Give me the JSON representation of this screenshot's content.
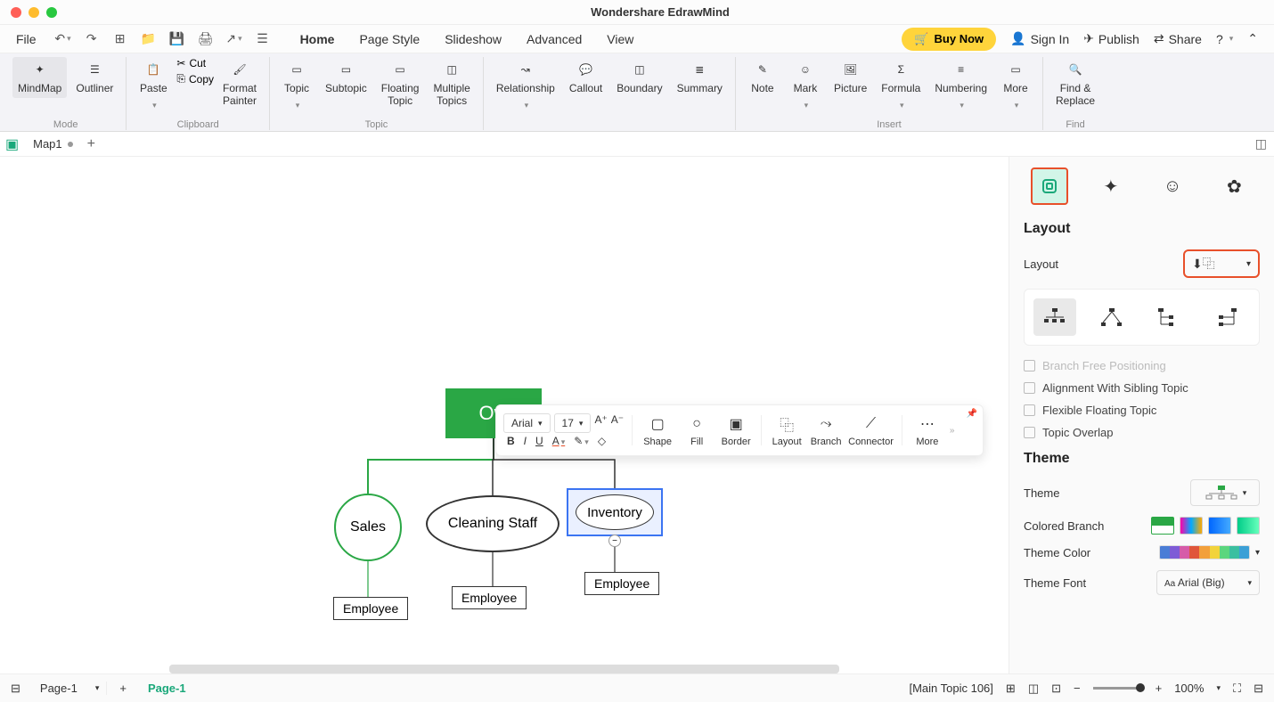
{
  "app_title": "Wondershare EdrawMind",
  "menubar": {
    "file": "File",
    "tabs": [
      "Home",
      "Page Style",
      "Slideshow",
      "Advanced",
      "View"
    ],
    "active_tab": "Home",
    "buy_now": "Buy Now",
    "sign_in": "Sign In",
    "publish": "Publish",
    "share": "Share"
  },
  "ribbon": {
    "mindmap": "MindMap",
    "outliner": "Outliner",
    "mode": "Mode",
    "paste": "Paste",
    "cut": "Cut",
    "copy": "Copy",
    "format_painter": "Format\nPainter",
    "clipboard": "Clipboard",
    "topic": "Topic",
    "subtopic": "Subtopic",
    "floating_topic": "Floating\nTopic",
    "multiple_topics": "Multiple\nTopics",
    "topic_group": "Topic",
    "relationship": "Relationship",
    "callout": "Callout",
    "boundary": "Boundary",
    "summary": "Summary",
    "note": "Note",
    "mark": "Mark",
    "picture": "Picture",
    "formula": "Formula",
    "numbering": "Numbering",
    "more": "More",
    "insert": "Insert",
    "find_replace": "Find &\nReplace",
    "find": "Find"
  },
  "doc_tab": "Map1",
  "canvas": {
    "owner": "Ow",
    "sales": "Sales",
    "cleaning_staff": "Cleaning Staff",
    "inventory": "Inventory",
    "employee": "Employee"
  },
  "float_toolbar": {
    "font_family": "Arial",
    "font_size": "17",
    "shape": "Shape",
    "fill": "Fill",
    "border": "Border",
    "layout": "Layout",
    "branch": "Branch",
    "connector": "Connector",
    "more": "More"
  },
  "side": {
    "layout_title": "Layout",
    "layout_label": "Layout",
    "branch_free": "Branch Free Positioning",
    "alignment_sibling": "Alignment With Sibling Topic",
    "flexible_floating": "Flexible Floating Topic",
    "topic_overlap": "Topic Overlap",
    "theme_title": "Theme",
    "theme_label": "Theme",
    "colored_branch": "Colored Branch",
    "theme_color": "Theme Color",
    "theme_font": "Theme Font",
    "theme_font_value": "Arial (Big)"
  },
  "statusbar": {
    "page_dd": "Page-1",
    "page_tab": "Page-1",
    "selection": "[Main Topic 106]",
    "zoom": "100%"
  },
  "colors": {
    "accent_green": "#2aa745",
    "highlight_orange": "#e8502a",
    "selection_blue": "#3b74f2",
    "buy_yellow": "#ffd43b"
  }
}
